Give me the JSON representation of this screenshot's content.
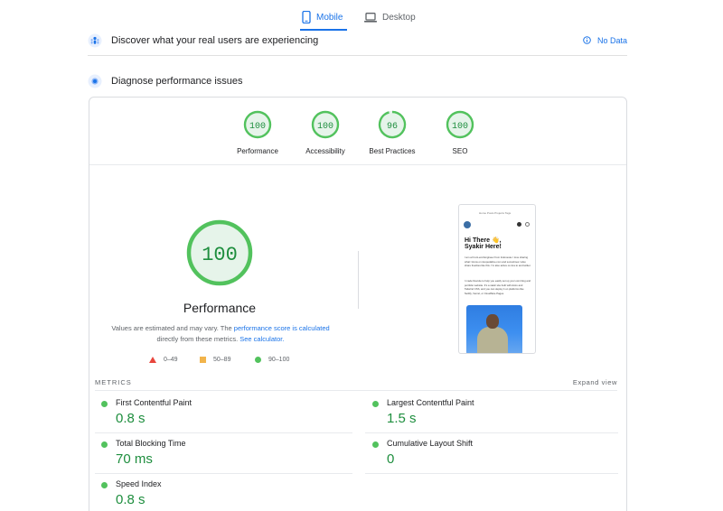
{
  "tabs": [
    {
      "label": "Mobile",
      "icon": "smartphone-icon",
      "active": true
    },
    {
      "label": "Desktop",
      "icon": "laptop-icon",
      "active": false
    }
  ],
  "discover": {
    "title": "Discover what your real users are experiencing",
    "status": "No Data",
    "icon": "users-icon"
  },
  "diagnose": {
    "title": "Diagnose performance issues",
    "icon": "lighthouse-icon"
  },
  "summary": [
    {
      "score": "100",
      "label": "Performance"
    },
    {
      "score": "100",
      "label": "Accessibility"
    },
    {
      "score": "96",
      "label": "Best Practices"
    },
    {
      "score": "100",
      "label": "SEO"
    }
  ],
  "main_score": {
    "score": "100",
    "title": "Performance"
  },
  "description": {
    "part1": "Values are estimated and may vary. The ",
    "link1": "performance score is calculated",
    "part2": " directly from these metrics. ",
    "link2": "See calculator."
  },
  "legend": [
    {
      "range": "0–49",
      "color": "#e8453c"
    },
    {
      "range": "50–89",
      "color": "#f2b44b"
    },
    {
      "range": "90–100",
      "color": "#52c25d"
    }
  ],
  "preview": {
    "nav": "Home  Posts  Projects  Tags",
    "headline1": "Hi There 👋,",
    "headline2": "Syakir Here!",
    "text1": "I am a Front-end Engineer from Indonesia. I love sharing what I know on devpedaline.com and sometimes I also share freebies like this. I'm also active on dev.to and twitter.",
    "text2": "I made Devsite to help you easily set up your own blog and portfolio website. It's a static site built with Astro and Tailwind CSS, and you can deploy it on platforms like Netlify, Vercel, or Cloudflare Pages."
  },
  "metrics": {
    "header": "METRICS",
    "expand": "Expand view",
    "items": [
      {
        "name": "First Contentful Paint",
        "value": "0.8 s"
      },
      {
        "name": "Largest Contentful Paint",
        "value": "1.5 s"
      },
      {
        "name": "Total Blocking Time",
        "value": "70 ms"
      },
      {
        "name": "Cumulative Layout Shift",
        "value": "0"
      },
      {
        "name": "Speed Index",
        "value": "0.8 s"
      }
    ]
  },
  "colors": {
    "accent": "#1a73e8",
    "pass": "#1e8e3e",
    "pass_ring": "#52c25d",
    "pass_fill": "#e6f4ea"
  }
}
